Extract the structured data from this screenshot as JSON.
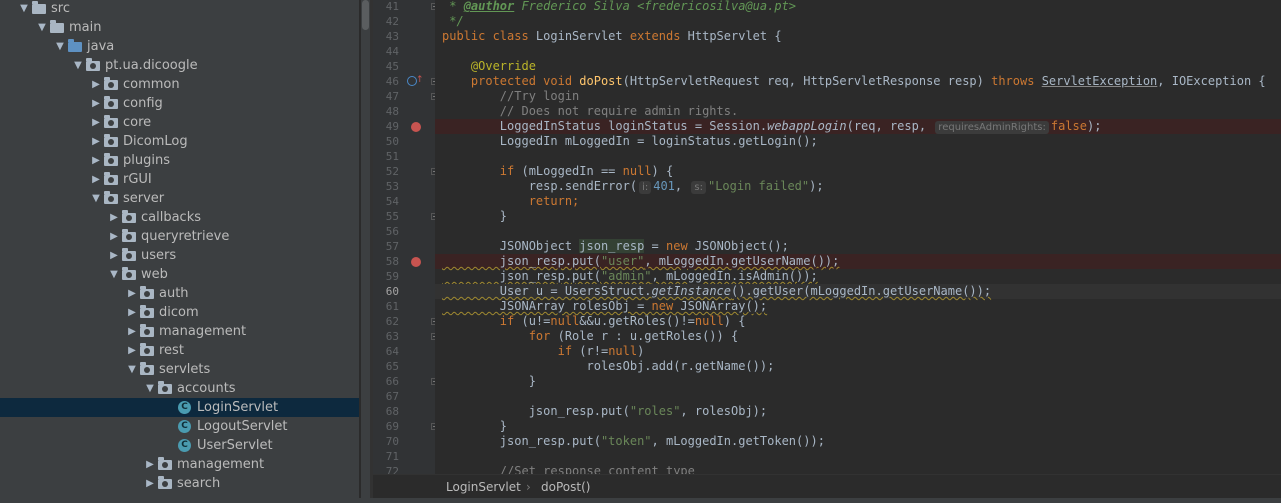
{
  "tree": {
    "rows": [
      {
        "label": "src",
        "arrow": "▼",
        "icon": "folder"
      },
      {
        "label": "main",
        "arrow": "▼",
        "icon": "folder"
      },
      {
        "label": "java",
        "arrow": "▼",
        "icon": "folder-blue"
      },
      {
        "label": "pt.ua.dicoogle",
        "arrow": "▼",
        "icon": "package"
      },
      {
        "label": "common",
        "arrow": "▶",
        "icon": "package"
      },
      {
        "label": "config",
        "arrow": "▶",
        "icon": "package"
      },
      {
        "label": "core",
        "arrow": "▶",
        "icon": "package"
      },
      {
        "label": "DicomLog",
        "arrow": "▶",
        "icon": "package"
      },
      {
        "label": "plugins",
        "arrow": "▶",
        "icon": "package"
      },
      {
        "label": "rGUI",
        "arrow": "▶",
        "icon": "package"
      },
      {
        "label": "server",
        "arrow": "▼",
        "icon": "package"
      },
      {
        "label": "callbacks",
        "arrow": "▶",
        "icon": "package"
      },
      {
        "label": "queryretrieve",
        "arrow": "▶",
        "icon": "package"
      },
      {
        "label": "users",
        "arrow": "▶",
        "icon": "package"
      },
      {
        "label": "web",
        "arrow": "▼",
        "icon": "package"
      },
      {
        "label": "auth",
        "arrow": "▶",
        "icon": "package"
      },
      {
        "label": "dicom",
        "arrow": "▶",
        "icon": "package"
      },
      {
        "label": "management",
        "arrow": "▶",
        "icon": "package"
      },
      {
        "label": "rest",
        "arrow": "▶",
        "icon": "package"
      },
      {
        "label": "servlets",
        "arrow": "▼",
        "icon": "package"
      },
      {
        "label": "accounts",
        "arrow": "▼",
        "icon": "package"
      },
      {
        "label": "LoginServlet",
        "arrow": "",
        "icon": "class",
        "selected": true
      },
      {
        "label": "LogoutServlet",
        "arrow": "",
        "icon": "class"
      },
      {
        "label": "UserServlet",
        "arrow": "",
        "icon": "class"
      },
      {
        "label": "management",
        "arrow": "▶",
        "icon": "package"
      },
      {
        "label": "search",
        "arrow": "▶",
        "icon": "package"
      }
    ],
    "class_icon_letter": "C"
  },
  "editor": {
    "line_numbers": [
      "41",
      "42",
      "43",
      "44",
      "45",
      "46",
      "47",
      "48",
      "49",
      "50",
      "51",
      "52",
      "53",
      "54",
      "55",
      "56",
      "57",
      "58",
      "59",
      "60",
      "61",
      "62",
      "63",
      "64",
      "65",
      "66",
      "67",
      "68",
      "69",
      "70",
      "71",
      "72"
    ],
    "current_line": "60",
    "breakpoint_lines": [
      "49",
      "58"
    ],
    "override_line": "46",
    "hints": {
      "requires_admin": "requiresAdminRights:",
      "i": "i:",
      "s": "s:"
    },
    "code": {
      "l41_a": " * ",
      "l41_tag": "@author",
      "l41_b": " Frederico Silva <fredericosilva@ua.pt>",
      "l42": " */",
      "l43_kw": "public class ",
      "l43_name": "LoginServlet ",
      "l43_kw2": "extends ",
      "l43_b": "HttpServlet {",
      "l45": "    @Override",
      "l46_kw": "    protected void ",
      "l46_fn": "doPost",
      "l46_a": "(HttpServletRequest req, HttpServletResponse resp) ",
      "l46_kw2": "throws ",
      "l46_dep": "ServletException",
      "l46_b": ", IOException {",
      "l47": "        //Try login",
      "l48": "        // Does not require admin rights.",
      "l49_a": "        LoggedInStatus loginStatus = Session.",
      "l49_it": "webappLogin",
      "l49_b": "(req, resp, ",
      "l49_kw": "false",
      "l49_c": ");",
      "l50": "        LoggedIn mLoggedIn = loginStatus.getLogin();",
      "l52_kw": "        if ",
      "l52_a": "(mLoggedIn == ",
      "l52_kw2": "null",
      "l52_b": ") {",
      "l53_a": "            resp.sendError(",
      "l53_num": "401",
      "l53_b": ", ",
      "l53_str": "\"Login failed\"",
      "l53_c": ");",
      "l54": "            return;",
      "l55": "        }",
      "l57_a": "        JSONObject ",
      "l57_var": "json_resp",
      "l57_b": " = ",
      "l57_kw": "new ",
      "l57_c": "JSONObject();",
      "l58_a": "        json_resp.put(",
      "l58_str": "\"user\"",
      "l58_b": ", mLoggedIn.getUserName());",
      "l59_a": "        json_resp.put(",
      "l59_str": "\"admin\"",
      "l59_b": ", mLoggedIn.isAdmin());",
      "l60_a": "        User u = UsersStruct.",
      "l60_it": "getInstance",
      "l60_b": "().getUser(mLoggedIn.getUserName());",
      "l61_a": "        JSONArray rolesObj = ",
      "l61_kw": "new ",
      "l61_b": "JSONArray();",
      "l62_kw": "        if ",
      "l62_a": "(u!=",
      "l62_kw2": "null",
      "l62_b": "&&u.getRoles()!=",
      "l62_kw3": "null",
      "l62_c": ") {",
      "l63_kw": "            for ",
      "l63_a": "(Role r : u.getRoles()) {",
      "l64_kw": "                if ",
      "l64_a": "(r!=",
      "l64_kw2": "null",
      "l64_b": ")",
      "l65": "                    rolesObj.add(r.getName());",
      "l66": "            }",
      "l68_a": "            json_resp.put(",
      "l68_str": "\"roles\"",
      "l68_b": ", rolesObj);",
      "l69": "        }",
      "l70_a": "        json_resp.put(",
      "l70_str": "\"token\"",
      "l70_b": ", mLoggedIn.getToken());",
      "l72": "        //Set response content type"
    }
  },
  "breadcrumb": {
    "items": [
      "LoginServlet",
      "doPost()"
    ],
    "separator": "›"
  },
  "colors": {
    "tree_bg": "#3c3f41",
    "editor_bg": "#2b2b2b",
    "selection": "#0d293e",
    "keyword": "#cc7832",
    "string": "#6a8759",
    "breakpoint": "#c75450"
  }
}
